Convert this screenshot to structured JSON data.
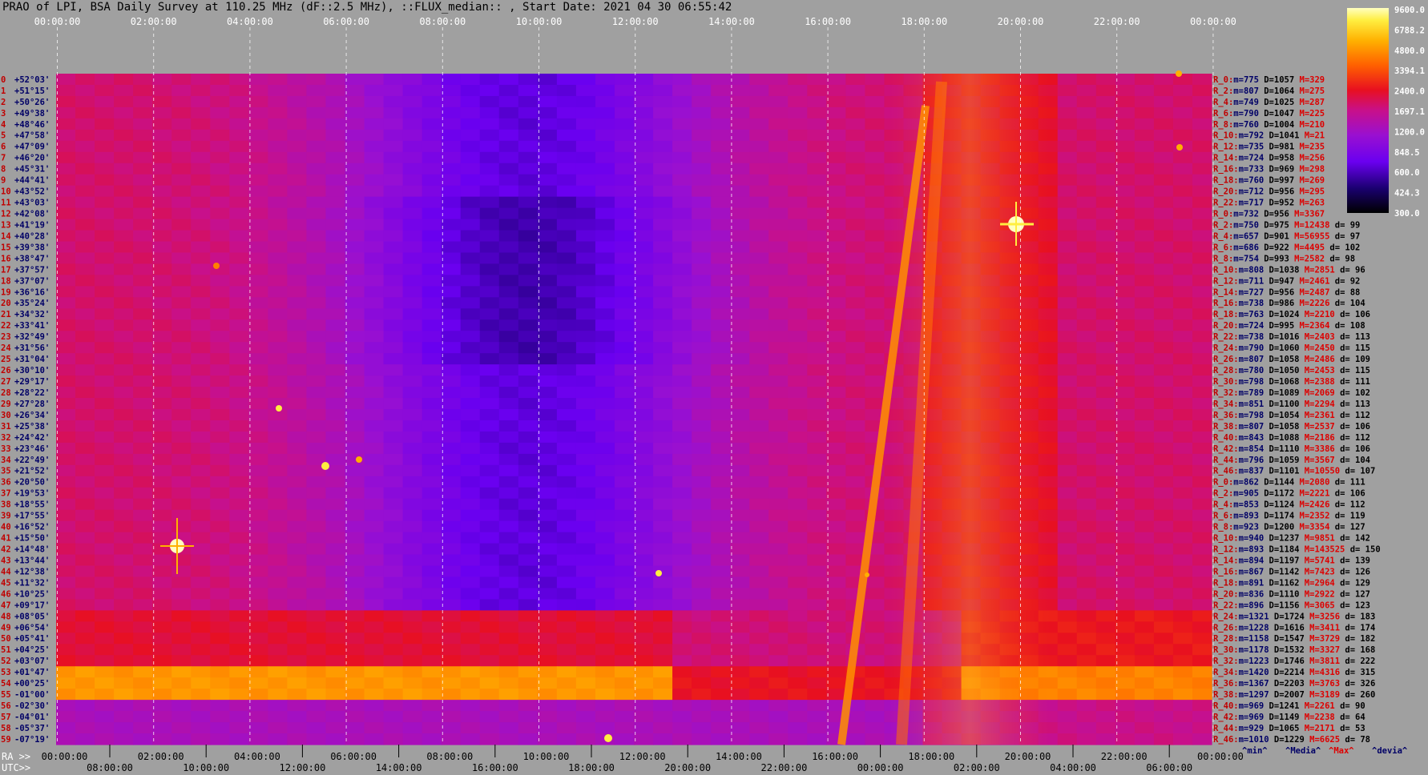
{
  "header": {
    "title": "PRAO of LPI, BSA Daily Survey at 110.25 MHz (dF::2.5 MHz), ::FLUX_median:: , Start Date: 2021 04 30 06:55:42"
  },
  "chart_data": {
    "type": "heatmap",
    "title": "PRAO of LPI, BSA Daily Survey at 110.25 MHz (dF::2.5 MHz), ::FLUX_median:: , Start Date: 2021 04 30 06:55:42",
    "top_axis_ticks": [
      "00:00:00",
      "02:00:00",
      "04:00:00",
      "06:00:00",
      "08:00:00",
      "10:00:00",
      "12:00:00",
      "14:00:00",
      "16:00:00",
      "18:00:00",
      "20:00:00",
      "22:00:00",
      "00:00:00"
    ],
    "ra_axis_prefix": "RA >>",
    "ra_axis_ticks": [
      "00:00:00",
      "02:00:00",
      "04:00:00",
      "06:00:00",
      "08:00:00",
      "10:00:00",
      "12:00:00",
      "14:00:00",
      "16:00:00",
      "18:00:00",
      "20:00:00",
      "22:00:00",
      "00:00:00"
    ],
    "utc_axis_prefix": "UTC>>",
    "utc_axis_ticks": [
      "08:00:00",
      "10:00:00",
      "12:00:00",
      "14:00:00",
      "16:00:00",
      "18:00:00",
      "20:00:00",
      "22:00:00",
      "00:00:00",
      "02:00:00",
      "04:00:00",
      "06:00:00"
    ],
    "colorbar_ticks": [
      "9600.0",
      "6788.2",
      "4800.0",
      "3394.1",
      "2400.0",
      "1697.1",
      "1200.0",
      "848.5",
      "600.0",
      "424.3",
      "300.0"
    ],
    "colorbar_range": [
      300,
      9600
    ],
    "colorbar_scale": "log",
    "declinations": [
      "+52°03'",
      "+51°15'",
      "+50°26'",
      "+49°38'",
      "+48°46'",
      "+47°58'",
      "+47°09'",
      "+46°20'",
      "+45°31'",
      "+44°41'",
      "+43°52'",
      "+43°03'",
      "+42°08'",
      "+41°19'",
      "+40°28'",
      "+39°38'",
      "+38°47'",
      "+37°57'",
      "+37°07'",
      "+36°16'",
      "+35°24'",
      "+34°32'",
      "+33°41'",
      "+32°49'",
      "+31°56'",
      "+31°04'",
      "+30°10'",
      "+29°17'",
      "+28°22'",
      "+27°28'",
      "+26°34'",
      "+25°38'",
      "+24°42'",
      "+23°46'",
      "+22°49'",
      "+21°52'",
      "+20°50'",
      "+19°53'",
      "+18°55'",
      "+17°55'",
      "+16°52'",
      "+15°50'",
      "+14°48'",
      "+13°44'",
      "+12°38'",
      "+11°32'",
      "+10°25'",
      "+09°17'",
      "+08°05'",
      "+06°54'",
      "+05°41'",
      "+04°25'",
      "+03°07'",
      "+01°47'",
      "+00°25'",
      "-01°00'",
      "-02°30'",
      "-04°01'",
      "-05°37'",
      "-07°19'"
    ],
    "stats": [
      {
        "r": "R_0:",
        "m": "775",
        "D": "1057",
        "M": "329",
        "d": ""
      },
      {
        "r": "R_2:",
        "m": "807",
        "D": "1064",
        "M": "275",
        "d": ""
      },
      {
        "r": "R_4:",
        "m": "749",
        "D": "1025",
        "M": "287",
        "d": ""
      },
      {
        "r": "R_6:",
        "m": "790",
        "D": "1047",
        "M": "225",
        "d": ""
      },
      {
        "r": "R_8:",
        "m": "760",
        "D": "1004",
        "M": "210",
        "d": ""
      },
      {
        "r": "R_10:",
        "m": "792",
        "D": "1041",
        "M": "21",
        "d": ""
      },
      {
        "r": "R_12:",
        "m": "735",
        "D": "981",
        "M": "235",
        "d": ""
      },
      {
        "r": "R_14:",
        "m": "724",
        "D": "958",
        "M": "256",
        "d": ""
      },
      {
        "r": "R_16:",
        "m": "733",
        "D": "969",
        "M": "298",
        "d": ""
      },
      {
        "r": "R_18:",
        "m": "760",
        "D": "997",
        "M": "269",
        "d": ""
      },
      {
        "r": "R_20:",
        "m": "712",
        "D": "956",
        "M": "295",
        "d": ""
      },
      {
        "r": "R_22:",
        "m": "717",
        "D": "952",
        "M": "263",
        "d": ""
      },
      {
        "r": "R_0:",
        "m": "732",
        "D": "956",
        "M": "3367",
        "d": ""
      },
      {
        "r": "R_2:",
        "m": "750",
        "D": "975",
        "M": "12438",
        "d": "99"
      },
      {
        "r": "R_4:",
        "m": "657",
        "D": "901",
        "M": "56955",
        "d": "97"
      },
      {
        "r": "R_6:",
        "m": "686",
        "D": "922",
        "M": "4495",
        "d": "102"
      },
      {
        "r": "R_8:",
        "m": "754",
        "D": "993",
        "M": "2582",
        "d": "98"
      },
      {
        "r": "R_10:",
        "m": "808",
        "D": "1038",
        "M": "2851",
        "d": "96"
      },
      {
        "r": "R_12:",
        "m": "711",
        "D": "947",
        "M": "2461",
        "d": "92"
      },
      {
        "r": "R_14:",
        "m": "727",
        "D": "956",
        "M": "2487",
        "d": "88"
      },
      {
        "r": "R_16:",
        "m": "738",
        "D": "986",
        "M": "2226",
        "d": "104"
      },
      {
        "r": "R_18:",
        "m": "763",
        "D": "1024",
        "M": "2210",
        "d": "106"
      },
      {
        "r": "R_20:",
        "m": "724",
        "D": "995",
        "M": "2364",
        "d": "108"
      },
      {
        "r": "R_22:",
        "m": "738",
        "D": "1016",
        "M": "2403",
        "d": "113"
      },
      {
        "r": "R_24:",
        "m": "790",
        "D": "1060",
        "M": "2450",
        "d": "115"
      },
      {
        "r": "R_26:",
        "m": "807",
        "D": "1058",
        "M": "2486",
        "d": "109"
      },
      {
        "r": "R_28:",
        "m": "780",
        "D": "1050",
        "M": "2453",
        "d": "115"
      },
      {
        "r": "R_30:",
        "m": "798",
        "D": "1068",
        "M": "2388",
        "d": "111"
      },
      {
        "r": "R_32:",
        "m": "789",
        "D": "1089",
        "M": "2069",
        "d": "102"
      },
      {
        "r": "R_34:",
        "m": "851",
        "D": "1100",
        "M": "2294",
        "d": "113"
      },
      {
        "r": "R_36:",
        "m": "798",
        "D": "1054",
        "M": "2361",
        "d": "112"
      },
      {
        "r": "R_38:",
        "m": "807",
        "D": "1058",
        "M": "2537",
        "d": "106"
      },
      {
        "r": "R_40:",
        "m": "843",
        "D": "1088",
        "M": "2186",
        "d": "112"
      },
      {
        "r": "R_42:",
        "m": "854",
        "D": "1110",
        "M": "3386",
        "d": "106"
      },
      {
        "r": "R_44:",
        "m": "796",
        "D": "1059",
        "M": "3567",
        "d": "104"
      },
      {
        "r": "R_46:",
        "m": "837",
        "D": "1101",
        "M": "10550",
        "d": "107"
      },
      {
        "r": "R_0:",
        "m": "862",
        "D": "1144",
        "M": "2080",
        "d": "111"
      },
      {
        "r": "R_2:",
        "m": "905",
        "D": "1172",
        "M": "2221",
        "d": "106"
      },
      {
        "r": "R_4:",
        "m": "853",
        "D": "1124",
        "M": "2426",
        "d": "112"
      },
      {
        "r": "R_6:",
        "m": "893",
        "D": "1174",
        "M": "2352",
        "d": "119"
      },
      {
        "r": "R_8:",
        "m": "923",
        "D": "1200",
        "M": "3354",
        "d": "127"
      },
      {
        "r": "R_10:",
        "m": "940",
        "D": "1237",
        "M": "9851",
        "d": "142"
      },
      {
        "r": "R_12:",
        "m": "893",
        "D": "1184",
        "M": "143525",
        "d": "150"
      },
      {
        "r": "R_14:",
        "m": "894",
        "D": "1197",
        "M": "5741",
        "d": "139"
      },
      {
        "r": "R_16:",
        "m": "867",
        "D": "1142",
        "M": "7423",
        "d": "126"
      },
      {
        "r": "R_18:",
        "m": "891",
        "D": "1162",
        "M": "2964",
        "d": "129"
      },
      {
        "r": "R_20:",
        "m": "836",
        "D": "1110",
        "M": "2922",
        "d": "127"
      },
      {
        "r": "R_22:",
        "m": "896",
        "D": "1156",
        "M": "3065",
        "d": "123"
      },
      {
        "r": "R_24:",
        "m": "1321",
        "D": "1724",
        "M": "3256",
        "d": "183"
      },
      {
        "r": "R_26:",
        "m": "1228",
        "D": "1616",
        "M": "3411",
        "d": "174"
      },
      {
        "r": "R_28:",
        "m": "1158",
        "D": "1547",
        "M": "3729",
        "d": "182"
      },
      {
        "r": "R_30:",
        "m": "1178",
        "D": "1532",
        "M": "3327",
        "d": "168"
      },
      {
        "r": "R_32:",
        "m": "1223",
        "D": "1746",
        "M": "3811",
        "d": "222"
      },
      {
        "r": "R_34:",
        "m": "1420",
        "D": "2214",
        "M": "4316",
        "d": "315"
      },
      {
        "r": "R_36:",
        "m": "1367",
        "D": "2203",
        "M": "3763",
        "d": "326"
      },
      {
        "r": "R_38:",
        "m": "1297",
        "D": "2007",
        "M": "3189",
        "d": "260"
      },
      {
        "r": "R_40:",
        "m": "969",
        "D": "1241",
        "M": "2261",
        "d": "90"
      },
      {
        "r": "R_42:",
        "m": "969",
        "D": "1149",
        "M": "2238",
        "d": "64"
      },
      {
        "r": "R_44:",
        "m": "929",
        "D": "1065",
        "M": "2171",
        "d": "53"
      },
      {
        "r": "R_46:",
        "m": "1010",
        "D": "1229",
        "M": "6625",
        "d": "78"
      }
    ],
    "stats_footer": [
      "^min^",
      "^Media^",
      "^Max^",
      "^devia^"
    ],
    "bands": [
      {
        "from_row": 0,
        "to_row": 48,
        "base_level": 0.35
      },
      {
        "from_row": 48,
        "to_row": 53,
        "base_level": 0.58
      },
      {
        "from_row": 53,
        "to_row": 56,
        "base_level": 0.72
      },
      {
        "from_row": 56,
        "to_row": 60,
        "base_level": 0.42
      }
    ],
    "colors": {
      "background": "#a0a0a0",
      "title": "#000000",
      "row_index": "#c00000",
      "declination": "#000066",
      "stats_r": "#c00000",
      "stats_m": "#000066",
      "stats_D": "#000000",
      "stats_M": "#dd0000",
      "gridline": "#ffffff"
    }
  }
}
